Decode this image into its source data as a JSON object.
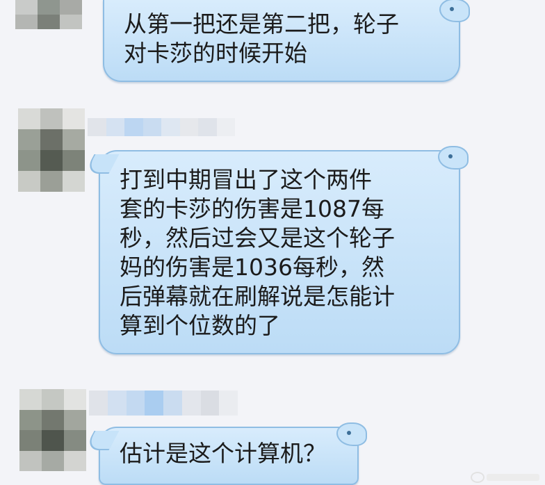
{
  "messages": [
    {
      "text": "从第一把还是第二把，轮子\n对卡莎的时候开始"
    },
    {
      "text": "打到中期冒出了这个两件\n套的卡莎的伤害是1087每\n秒，然后过会又是这个轮子\n妈的伤害是1036每秒，然\n后弹幕就在刷解说是怎能计\n算到个位数的了"
    },
    {
      "text": "估计是这个计算机？"
    }
  ],
  "colors": {
    "background": "#f3f4f8",
    "bubble_fill": "#c7e3f9",
    "bubble_border": "#8fbde3",
    "text": "#1b1b1b"
  },
  "icons": {
    "avatar": "pixelated-avatar-icon",
    "sender_name": "pixelated-name-redaction",
    "bubble_decoration": "whale-ear-icon",
    "watermark": "weibo-watermark-icon"
  }
}
